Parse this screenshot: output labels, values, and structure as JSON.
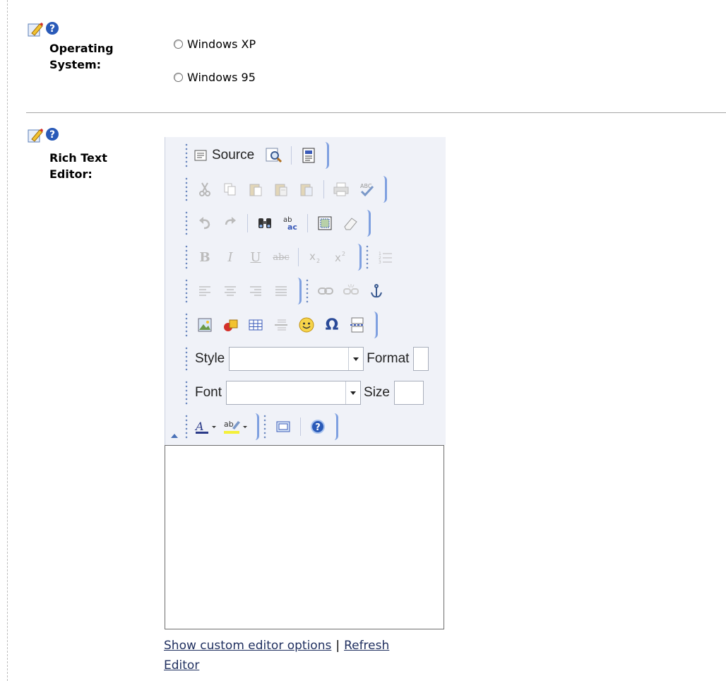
{
  "operating_system": {
    "label_line1": "Operating",
    "label_line2": "System:",
    "options": [
      "Windows XP",
      "Windows 95"
    ]
  },
  "rich_text_editor": {
    "label_line1": "Rich Text",
    "label_line2": "Editor:",
    "toolbar": {
      "source_label": "Source",
      "style_label": "Style",
      "format_label": "Format",
      "font_label": "Font",
      "size_label": "Size",
      "bold_glyph": "B",
      "italic_glyph": "I",
      "underline_glyph": "U",
      "strike_glyph": "abc",
      "omega_glyph": "Ω"
    }
  },
  "links": {
    "show_options": "Show custom editor options",
    "separator": "|",
    "refresh": "Refresh",
    "editor": "Editor"
  },
  "colors": {
    "toolbar_bg": "#f0f2f8",
    "group_border": "#7fa0e0",
    "link": "#1f2f5f"
  }
}
